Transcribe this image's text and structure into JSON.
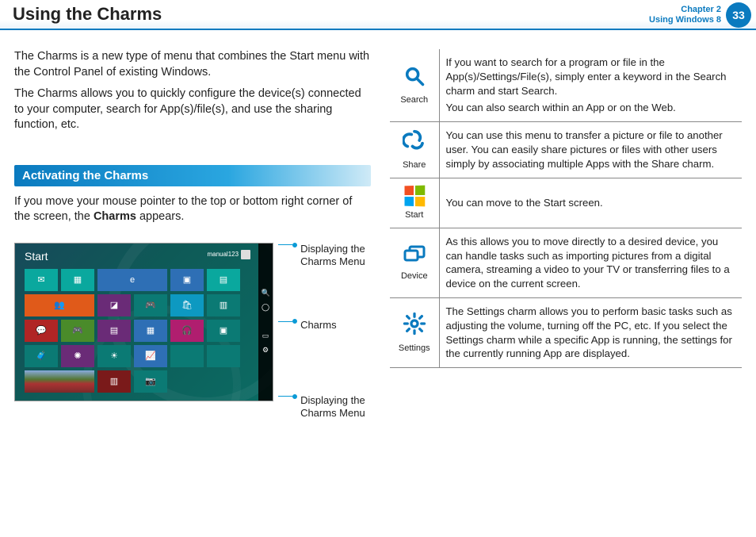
{
  "header": {
    "title": "Using the Charms",
    "chapter_line1": "Chapter 2",
    "chapter_line2": "Using Windows 8",
    "page_number": "33"
  },
  "intro": {
    "p1": "The Charms is a new type of menu that combines the Start menu with the Control Panel of existing Windows.",
    "p2": "The Charms allows you to quickly configure the device(s) connected to your computer, search for App(s)/file(s), and use the sharing function, etc."
  },
  "section": {
    "heading": "Activating the Charms",
    "body_prefix": "If you move your mouse pointer to the top or bottom right corner of the screen, the ",
    "body_bold": "Charms",
    "body_suffix": " appears."
  },
  "mock": {
    "start_label": "Start",
    "user_label": "manual123"
  },
  "callouts": {
    "top": "Displaying the Charms Menu",
    "mid": "Charms",
    "bottom": "Displaying the Charms Menu"
  },
  "charms": {
    "search": {
      "label": "Search",
      "p1": "If you want to search for a program or file in the App(s)/Settings/File(s), simply enter a keyword in the Search charm and start Search.",
      "p2": "You can also search within an App or on the Web."
    },
    "share": {
      "label": "Share",
      "p1": "You can use this menu to transfer a picture or file to another user. You can easily share pictures or files with other users simply by associating multiple Apps with the Share charm."
    },
    "start": {
      "label": "Start",
      "p1": "You can move to the Start screen."
    },
    "device": {
      "label": "Device",
      "p1": "As this allows you to move directly to a desired device, you can handle tasks such as importing pictures from a digital camera, streaming a video to your TV or transferring files to a device on the current screen."
    },
    "settings": {
      "label": "Settings",
      "p1": "The Settings charm allows you to perform basic tasks such as adjusting the volume, turning off the PC, etc. If you select the Settings charm while a specific App is running, the settings for the currently running App are displayed."
    }
  }
}
